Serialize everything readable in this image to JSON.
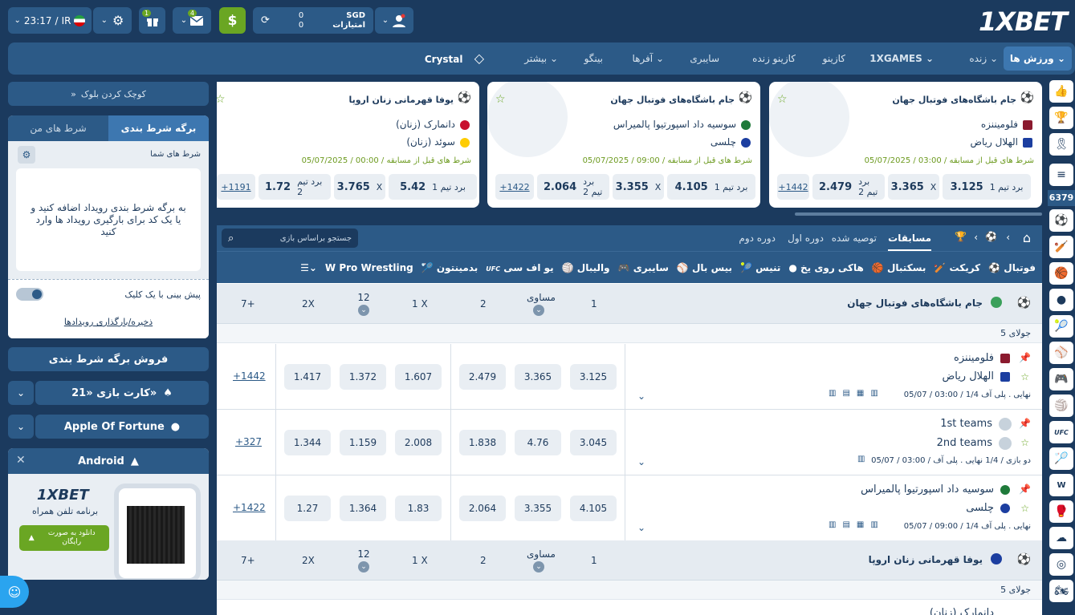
{
  "header": {
    "logo": "1XBET",
    "balance_currency": "SGD",
    "balance_value": "0",
    "points_label": "امتیازات",
    "points_value": "0",
    "gift_badge": "1",
    "mail_badge": "4",
    "time": "23:17",
    "region": "IR",
    "dollar_icon": "$"
  },
  "nav": {
    "items": [
      "ورزش ها",
      "زنده",
      "1XGAMES",
      "کازینو",
      "کازینو زنده",
      "سایبری",
      "آفرها",
      "بینگو",
      "بیشتر",
      "Crystal"
    ]
  },
  "right_rail": {
    "counter": "6379"
  },
  "cards": [
    {
      "league": "جام باشگاه‌های فوتبال جهان",
      "team1": "فلومیننزه",
      "team2": "الهلال ریاض",
      "date": "05/07/2025 / 03:00 / شرط های قبل از مسابقه",
      "w1_label": "برد تیم 1",
      "w1": "3.125",
      "x_label": "X",
      "x": "3.365",
      "w2_label": "برد تیم 2",
      "w2": "2.479",
      "more": "+1442"
    },
    {
      "league": "جام باشگاه‌های فوتبال جهان",
      "team1": "سوسیه داد اسپورتیوا پالمیراس",
      "team2": "چلسی",
      "date": "05/07/2025 / 09:00 / شرط های قبل از مسابقه",
      "w1_label": "برد تیم 1",
      "w1": "4.105",
      "x_label": "X",
      "x": "3.355",
      "w2_label": "برد تیم 2",
      "w2": "2.064",
      "more": "+1422"
    },
    {
      "league": "یوفا قهرمانی زنان اروپا",
      "team1": "دانمارک (زنان)",
      "team2": "سوئد (زنان)",
      "date": "05/07/2025 / 00:00 / شرط های قبل از مسابقه",
      "w1_label": "برد تیم 1",
      "w1": "5.42",
      "x_label": "X",
      "x": "3.765",
      "w2_label": "برد تیم 2",
      "w2": "1.72",
      "more": "+1191"
    }
  ],
  "main_tabs": {
    "matches": "مسابقات",
    "recommended": "توصیه شده",
    "first_half": "دوره اول",
    "second_half": "دوره دوم",
    "search_placeholder": "جستجو براساس بازی"
  },
  "sports": [
    "فوتبال",
    "کریکت",
    "بسکتبال",
    "هاکی روی یخ",
    "تنیس",
    "بیس بال",
    "سایبری",
    "والیبال",
    "یو اف سی",
    "بدمینتون",
    "Pro Wrestling"
  ],
  "groups": [
    {
      "league": "جام باشگاه‌های فوتبال جهان",
      "cols": {
        "c1": "1",
        "cx": "مساوی",
        "c2": "2",
        "c1x": "1 X",
        "c12": "12",
        "c2x": "2X",
        "more": "7+"
      },
      "day": "5 جولای",
      "matches": [
        {
          "team1": "فلومیننزه",
          "team2": "الهلال ریاض",
          "info": "05/07 / 03:00 / 1/4 نهایی . پلی آف",
          "odds": [
            "3.125",
            "3.365",
            "2.479",
            "1.607",
            "1.372",
            "1.417"
          ],
          "more": "+1442"
        },
        {
          "team1": "1st teams",
          "team2": "2nd teams",
          "info": "05/07 / 03:00 / دو بازی / 1/4 نهایی . پلی آف",
          "odds": [
            "3.045",
            "4.76",
            "1.838",
            "2.008",
            "1.159",
            "1.344"
          ],
          "more": "+327"
        },
        {
          "team1": "سوسیه داد اسپورتیوا پالمیراس",
          "team2": "چلسی",
          "info": "05/07 / 09:00 / 1/4 نهایی . پلی آف",
          "odds": [
            "4.105",
            "3.355",
            "2.064",
            "1.83",
            "1.364",
            "1.27"
          ],
          "more": "+1422"
        }
      ]
    },
    {
      "league": "یوفا قهرمانی زنان اروپا",
      "cols": {
        "c1": "1",
        "cx": "مساوی",
        "c2": "2",
        "c1x": "1 X",
        "c12": "12",
        "c2x": "2X",
        "more": "7+"
      },
      "day": "5 جولای",
      "next_team": "دانمارک (زنان)"
    }
  ],
  "left": {
    "collapse": "کوچک کردن بلوک",
    "tab_betslip": "برگه شرط بندی",
    "tab_mybets": "شرط های من",
    "your_bets": "شرط های شما",
    "empty_msg": "به برگه شرط بندی رویداد اضافه کنید و یا یک کد برای بارگیری رویداد ها وارد کنید",
    "one_click": "پیش بینی با یک کلیک",
    "save_load": "ذخیره/بارگذاری رویدادها",
    "sell_betslip": "فروش برگه شرط بندی",
    "card_game": "کارت بازی «21»",
    "apple_fortune": "Apple Of Fortune",
    "android": "Android",
    "promo_logo": "1XBET",
    "promo_text": "برنامه تلفن همراه",
    "download": "دانلود به صورت رایگان"
  },
  "colors": {
    "bg": "#1b3a5e",
    "panel": "#2c5a87",
    "green": "#6aa623",
    "accent": "#2aa4ef"
  }
}
